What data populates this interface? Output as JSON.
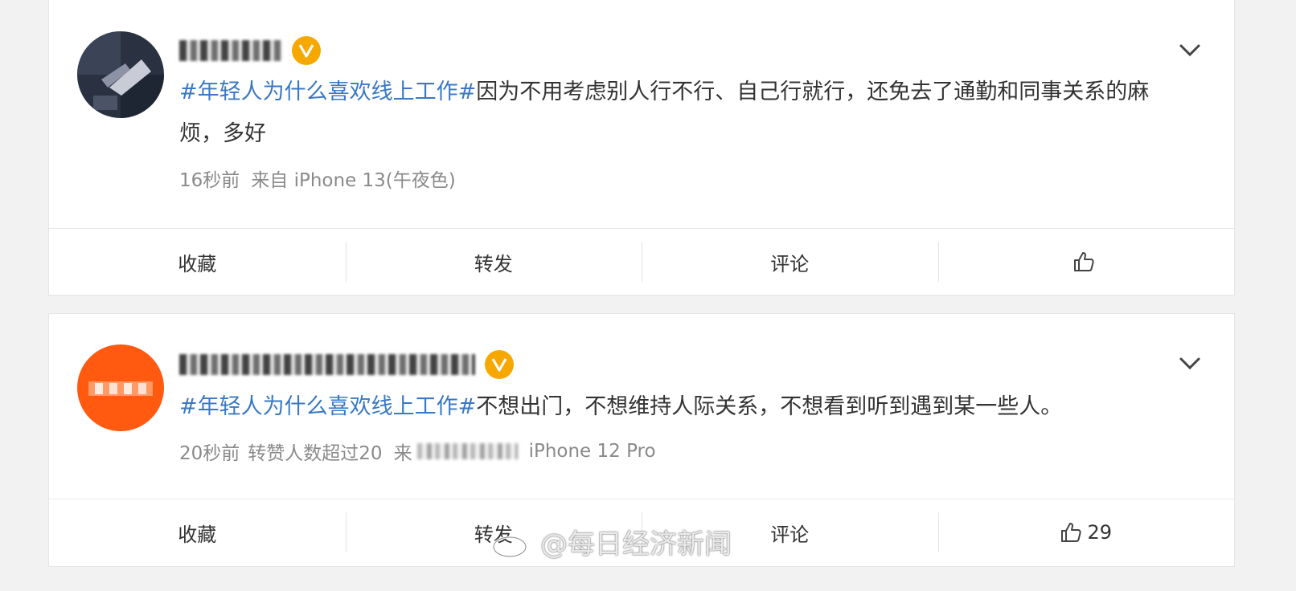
{
  "posts": [
    {
      "topic": "#年轻人为什么喜欢线上工作#",
      "content": "因为不用考虑别人行不行、自己行就行，还免去了通勤和同事关系的麻烦，多好",
      "time": "16秒前",
      "source": "来自 iPhone 13(午夜色)",
      "actions": {
        "favorite": "收藏",
        "repost": "转发",
        "comment": "评论",
        "like_count": ""
      }
    },
    {
      "topic": "#年轻人为什么喜欢线上工作#",
      "content": "不想出门，不想维持人际关系，不想看到听到遇到某一些人。",
      "time": "20秒前",
      "reposts_note": "转赞人数超过20",
      "source_prefix": "来",
      "source_device": "iPhone 12 Pro",
      "actions": {
        "favorite": "收藏",
        "repost": "转发",
        "comment": "评论",
        "like_count": "29"
      }
    }
  ],
  "watermark": "@每日经济新闻",
  "colors": {
    "topic": "#3a78c3",
    "verified_badge": "#f7a800",
    "avatar2": "#ff5a10"
  },
  "icons": [
    "chevron-down-icon",
    "thumbs-up-icon",
    "verified-badge-icon",
    "weibo-logo-icon"
  ]
}
